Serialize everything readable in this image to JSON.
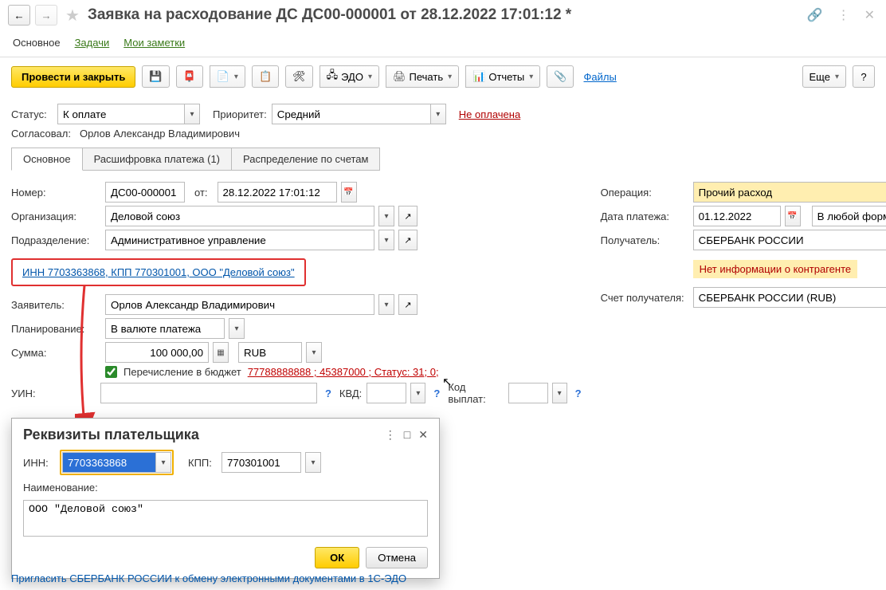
{
  "titlebar": {
    "title": "Заявка на расходование ДС ДС00-000001 от 28.12.2022 17:01:12 *"
  },
  "navtabs": {
    "main": "Основное",
    "tasks": "Задачи",
    "notes": "Мои заметки"
  },
  "toolbar": {
    "post_close": "Провести и закрыть",
    "edo": "ЭДО",
    "print": "Печать",
    "reports": "Отчеты",
    "files": "Файлы",
    "more": "Еще",
    "help": "?"
  },
  "status_row": {
    "status_lbl": "Статус:",
    "status_val": "К оплате",
    "priority_lbl": "Приоритет:",
    "priority_val": "Средний",
    "not_paid": "Не оплачена"
  },
  "agreed_row": {
    "lbl": "Согласовал:",
    "val": "Орлов Александр Владимирович"
  },
  "cardtabs": {
    "t1": "Основное",
    "t2": "Расшифровка платежа (1)",
    "t3": "Распределение по счетам"
  },
  "left": {
    "number_lbl": "Номер:",
    "number_val": "ДС00-000001",
    "from_lbl": "от:",
    "date_val": "28.12.2022 17:01:12",
    "org_lbl": "Организация:",
    "org_val": "Деловой союз",
    "dept_lbl": "Подразделение:",
    "dept_val": "Административное управление",
    "inn_link": "ИНН 7703363868, КПП 770301001, ООО \"Деловой союз\"",
    "appl_lbl": "Заявитель:",
    "appl_val": "Орлов Александр Владимирович",
    "plan_lbl": "Планирование:",
    "plan_val": "В валюте платежа",
    "sum_lbl": "Сумма:",
    "sum_val": "100 000,00",
    "curr_val": "RUB",
    "budget_chk": "Перечисление в бюджет",
    "budget_red": "77788888888          ; 45387000   ; Статус: 31; 0;",
    "uin_lbl": "УИН:",
    "kvd_lbl": "КВД:",
    "kodv_lbl": "Код выплат:"
  },
  "right": {
    "op_lbl": "Операция:",
    "op_val": "Прочий расход",
    "pdate_lbl": "Дата платежа:",
    "pdate_val": "01.12.2022",
    "form_val": "В любой форме",
    "recv_lbl": "Получатель:",
    "recv_val": "СБЕРБАНК РОССИИ",
    "warn": "Нет информации о контрагенте",
    "acct_lbl": "Счет получателя:",
    "acct_val": "СБЕРБАНК РОССИИ (RUB)"
  },
  "popup": {
    "title": "Реквизиты плательщика",
    "inn_lbl": "ИНН:",
    "inn_val": "7703363868",
    "kpp_lbl": "КПП:",
    "kpp_val": "770301001",
    "name_lbl": "Наименование:",
    "name_val": "ООО \"Деловой союз\"",
    "ok": "ОК",
    "cancel": "Отмена"
  },
  "bottom_link": "Пригласить СБЕРБАНК РОССИИ к обмену электронными документами в 1С-ЭДО"
}
